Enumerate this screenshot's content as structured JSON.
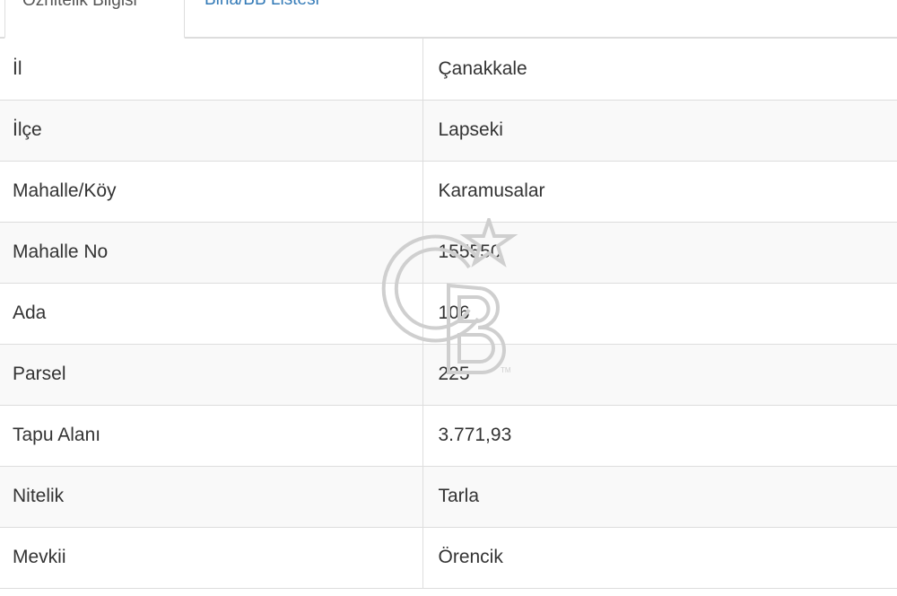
{
  "tabs": {
    "active_label": "Öznitelik Bilgisi",
    "inactive_label": "Bina/BB Listesi"
  },
  "attributes": [
    {
      "label": "İl",
      "value": "Çanakkale"
    },
    {
      "label": "İlçe",
      "value": "Lapseki"
    },
    {
      "label": "Mahalle/Köy",
      "value": "Karamusalar"
    },
    {
      "label": "Mahalle No",
      "value": "155550"
    },
    {
      "label": "Ada",
      "value": "106"
    },
    {
      "label": "Parsel",
      "value": "225"
    },
    {
      "label": "Tapu Alanı",
      "value": "3.771,93"
    },
    {
      "label": "Nitelik",
      "value": "Tarla"
    },
    {
      "label": "Mevkii",
      "value": "Örencik"
    }
  ],
  "watermark": {
    "text": "CB",
    "mark": "TM",
    "color": "#cccccc"
  }
}
